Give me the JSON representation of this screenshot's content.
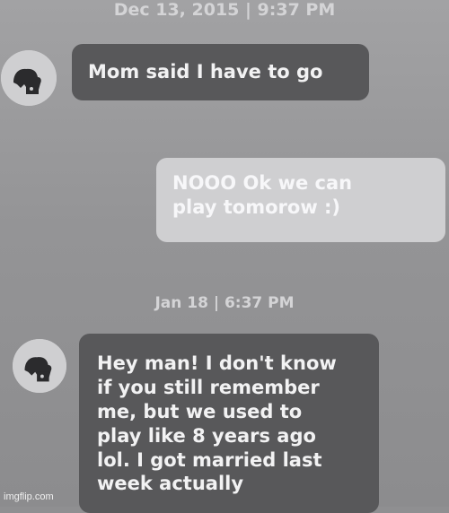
{
  "thread": {
    "timestamp_1": "Dec 13, 2015 | 9:37 PM",
    "message_1": "Mom said I have to go",
    "message_2_line_1": "NOOO Ok we can",
    "message_2_line_2": "play tomorow :)",
    "timestamp_2": "Jan 18 | 6:37 PM",
    "message_3_lines": [
      "Hey man! I don't know",
      "if you still remember",
      "me, but we used to",
      "play like 8 years ago",
      "lol. I got married last",
      "week actually"
    ]
  },
  "avatar_icon": "avatar-icon",
  "watermark": "imgflip.com"
}
